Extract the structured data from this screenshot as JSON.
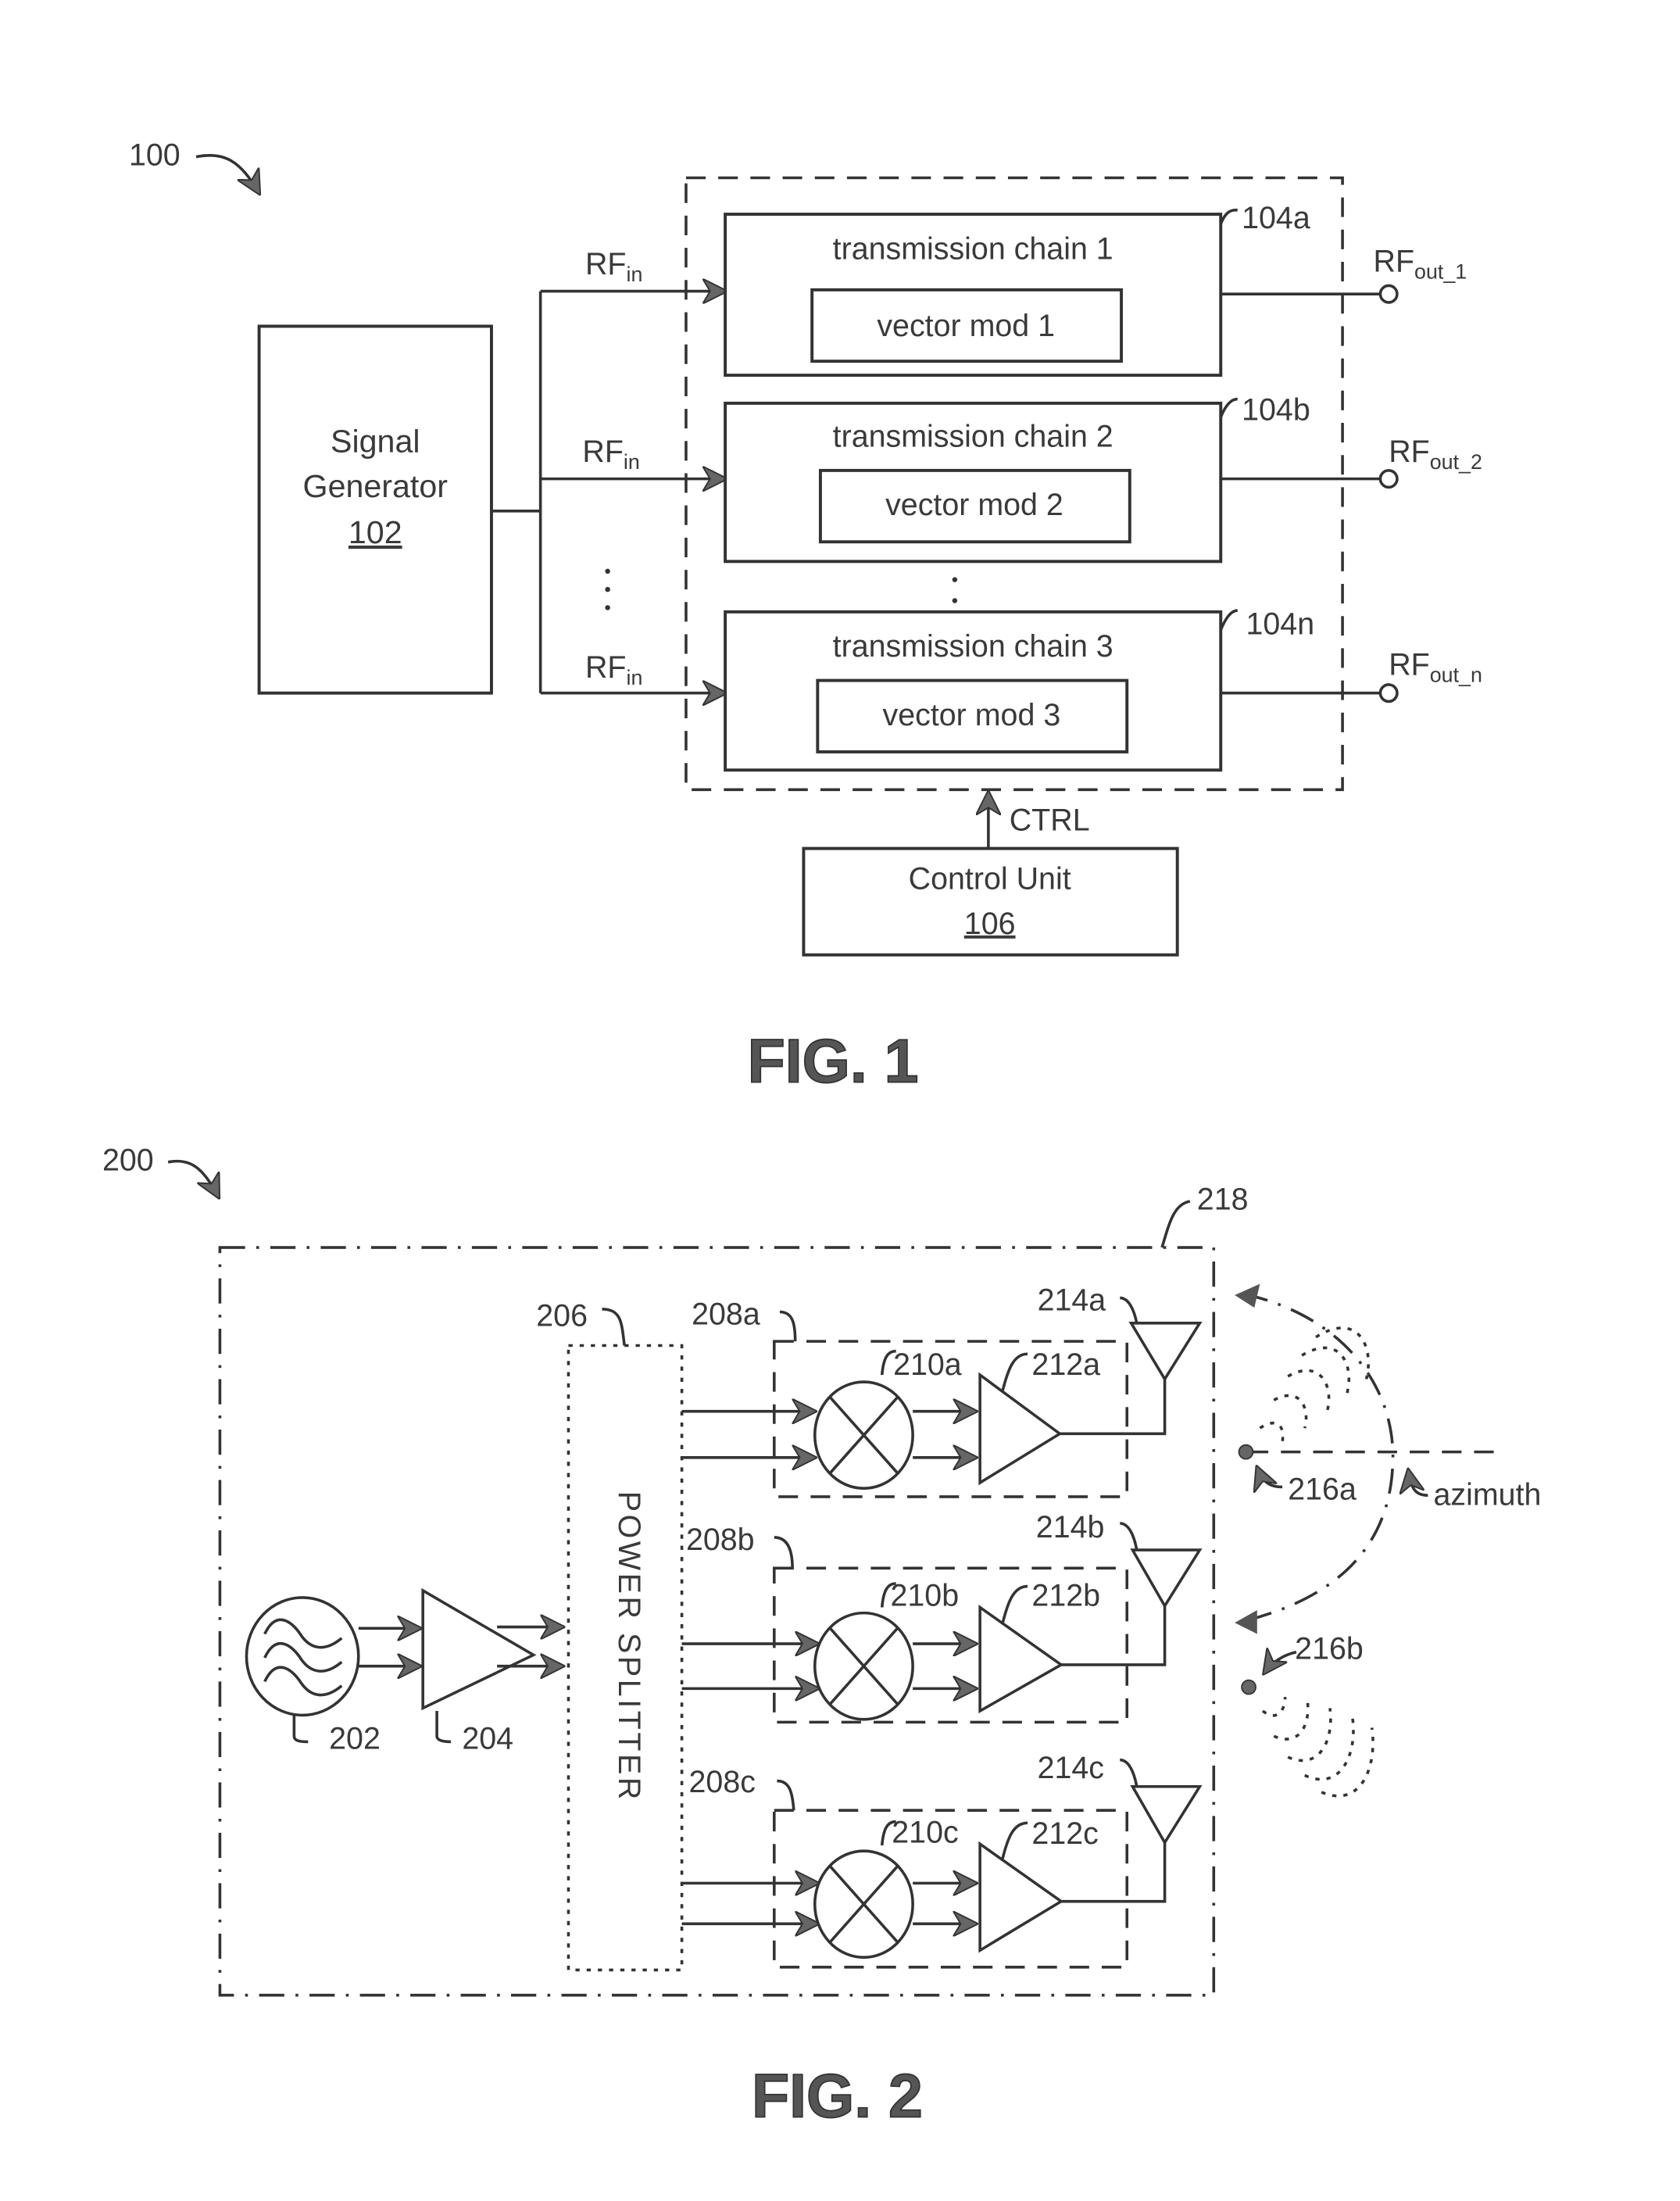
{
  "fig1": {
    "ref": "100",
    "signal_generator": {
      "line1": "Signal",
      "line2": "Generator",
      "ref": "102"
    },
    "rf_in_label": "RF",
    "rf_in_sub": "in",
    "chains": [
      {
        "title": "transmission chain 1",
        "mod": "vector mod 1",
        "ref": "104a",
        "out_label": "RF",
        "out_sub": "out_1"
      },
      {
        "title": "transmission chain 2",
        "mod": "vector mod 2",
        "ref": "104b",
        "out_label": "RF",
        "out_sub": "out_2"
      },
      {
        "title": "transmission chain 3",
        "mod": "vector mod 3",
        "ref": "104n",
        "out_label": "RF",
        "out_sub": "out_n"
      }
    ],
    "ctrl_label": "CTRL",
    "control_unit": {
      "line1": "Control Unit",
      "ref": "106"
    },
    "caption": "FIG. 1"
  },
  "fig2": {
    "ref": "200",
    "enclosure_ref": "218",
    "oscillator_ref": "202",
    "amplifier_ref": "204",
    "splitter_ref": "206",
    "splitter_label": "POWER SPLITTER",
    "channels": [
      {
        "box_ref": "208a",
        "mixer_ref": "210a",
        "amp_ref": "212a",
        "antenna_ref": "214a"
      },
      {
        "box_ref": "208b",
        "mixer_ref": "210b",
        "amp_ref": "212b",
        "antenna_ref": "214b"
      },
      {
        "box_ref": "208c",
        "mixer_ref": "210c",
        "amp_ref": "212c",
        "antenna_ref": "214c"
      }
    ],
    "target_a_ref": "216a",
    "target_b_ref": "216b",
    "azimuth_label": "azimuth",
    "caption": "FIG. 2"
  }
}
